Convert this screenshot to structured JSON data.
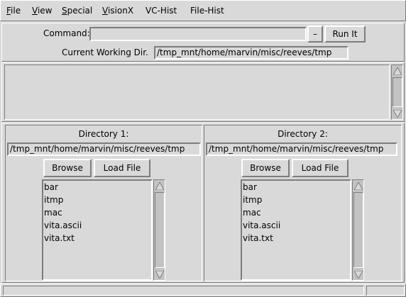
{
  "menu": {
    "items": [
      {
        "label": "File",
        "mnemonic": "F",
        "rest": "ile"
      },
      {
        "label": "View",
        "mnemonic": "V",
        "rest": "iew"
      },
      {
        "label": "Special",
        "mnemonic": "S",
        "rest": "pecial"
      },
      {
        "label": "VisionX",
        "mnemonic": "V",
        "rest": "isionX"
      },
      {
        "label": "VC-Hist",
        "mnemonic": "",
        "rest": "VC-Hist"
      },
      {
        "label": "File-Hist",
        "mnemonic": "",
        "rest": "File-Hist"
      }
    ]
  },
  "command": {
    "label": "Command:",
    "value": "",
    "dash_label": "–",
    "run_label": "Run It"
  },
  "cwd": {
    "label": "Current Working Dir.",
    "value": "/tmp_mnt/home/marvin/misc/reeves/tmp"
  },
  "dir1": {
    "title": "Directory 1:",
    "path": "/tmp_mnt/home/marvin/misc/reeves/tmp",
    "browse_label": "Browse",
    "load_label": "Load File",
    "files": [
      "bar",
      "itmp",
      "mac",
      "vita.ascii",
      "vita.txt"
    ]
  },
  "dir2": {
    "title": "Directory 2:",
    "path": "/tmp_mnt/home/marvin/misc/reeves/tmp",
    "browse_label": "Browse",
    "load_label": "Load File",
    "files": [
      "bar",
      "itmp",
      "mac",
      "vita.ascii",
      "vita.txt"
    ]
  },
  "icons": {
    "scroll_up": "up-arrow-icon",
    "scroll_down": "down-arrow-icon"
  }
}
